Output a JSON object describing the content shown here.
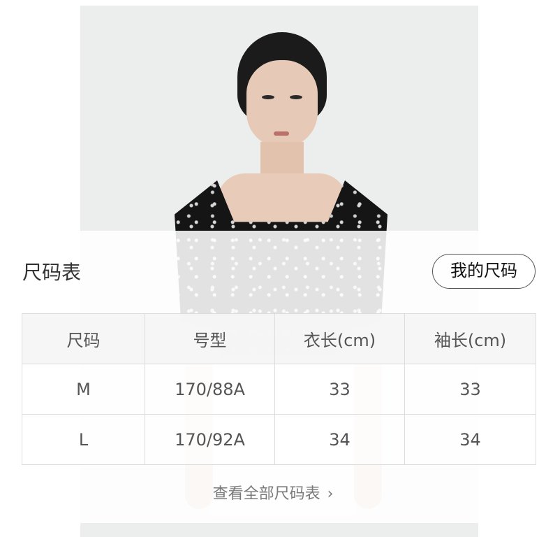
{
  "sheet": {
    "title": "尺码表",
    "my_size_button": "我的尺码",
    "view_all_link": "查看全部尺码表"
  },
  "table": {
    "headers": [
      "尺码",
      "号型",
      "衣长(cm)",
      "袖长(cm)"
    ],
    "rows": [
      [
        "M",
        "170/88A",
        "33",
        "33"
      ],
      [
        "L",
        "170/92A",
        "34",
        "34"
      ]
    ]
  },
  "icons": {
    "view_all_chevron": "chevron-right-icon"
  }
}
